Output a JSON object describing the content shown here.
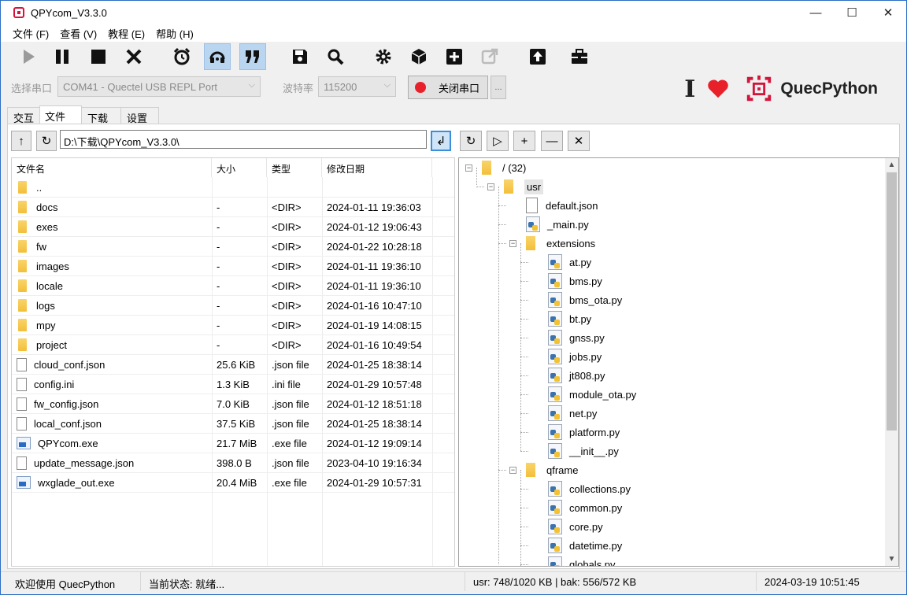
{
  "window": {
    "title": "QPYcom_V3.3.0",
    "controls": {
      "minimize": "—",
      "maximize": "☐",
      "close": "✕"
    }
  },
  "menu": [
    "文件 (F)",
    "查看 (V)",
    "教程 (E)",
    "帮助 (H)"
  ],
  "toolbar": {
    "buttons": [
      "play-icon",
      "pause-icon",
      "stop-icon",
      "cancel-icon",
      "alarm-clock-icon",
      "headset-icon",
      "quote-icon",
      "save-icon",
      "search-icon",
      "gear-icon",
      "cube-icon",
      "plus-icon",
      "external-link-icon",
      "upload-icon",
      "toolbox-icon"
    ]
  },
  "port": {
    "port_label": "选择串口",
    "port_value": "COM41 - Quectel USB REPL Port",
    "baud_label": "波特率",
    "baud_value": "115200",
    "close_button": "关闭串口",
    "more_button": "..."
  },
  "brand": {
    "text": "QuecPython",
    "cursor": "I"
  },
  "tabs": [
    "交互",
    "文件",
    "下载",
    "设置"
  ],
  "local": {
    "path": "D:\\下载\\QPYcom_V3.3.0\\",
    "columns": [
      "文件名",
      "大小",
      "类型",
      "修改日期"
    ],
    "rows": [
      {
        "name": "..",
        "size": "",
        "type": "",
        "date": "",
        "icon": "folder"
      },
      {
        "name": "docs",
        "size": "-",
        "type": "<DIR>",
        "date": "2024-01-11 19:36:03",
        "icon": "folder"
      },
      {
        "name": "exes",
        "size": "-",
        "type": "<DIR>",
        "date": "2024-01-12 19:06:43",
        "icon": "folder"
      },
      {
        "name": "fw",
        "size": "-",
        "type": "<DIR>",
        "date": "2024-01-22 10:28:18",
        "icon": "folder"
      },
      {
        "name": "images",
        "size": "-",
        "type": "<DIR>",
        "date": "2024-01-11 19:36:10",
        "icon": "folder"
      },
      {
        "name": "locale",
        "size": "-",
        "type": "<DIR>",
        "date": "2024-01-11 19:36:10",
        "icon": "folder"
      },
      {
        "name": "logs",
        "size": "-",
        "type": "<DIR>",
        "date": "2024-01-16 10:47:10",
        "icon": "folder"
      },
      {
        "name": "mpy",
        "size": "-",
        "type": "<DIR>",
        "date": "2024-01-19 14:08:15",
        "icon": "folder"
      },
      {
        "name": "project",
        "size": "-",
        "type": "<DIR>",
        "date": "2024-01-16 10:49:54",
        "icon": "folder"
      },
      {
        "name": "cloud_conf.json",
        "size": "25.6 KiB",
        "type": ".json file",
        "date": "2024-01-25 18:38:14",
        "icon": "file"
      },
      {
        "name": "config.ini",
        "size": "1.3 KiB",
        "type": ".ini file",
        "date": "2024-01-29 10:57:48",
        "icon": "file"
      },
      {
        "name": "fw_config.json",
        "size": "7.0 KiB",
        "type": ".json file",
        "date": "2024-01-12 18:51:18",
        "icon": "file"
      },
      {
        "name": "local_conf.json",
        "size": "37.5 KiB",
        "type": ".json file",
        "date": "2024-01-25 18:38:14",
        "icon": "file"
      },
      {
        "name": "QPYcom.exe",
        "size": "21.7 MiB",
        "type": ".exe file",
        "date": "2024-01-12 19:09:14",
        "icon": "exe"
      },
      {
        "name": "update_message.json",
        "size": "398.0 B",
        "type": ".json file",
        "date": "2023-04-10 19:16:34",
        "icon": "file"
      },
      {
        "name": "wxglade_out.exe",
        "size": "20.4 MiB",
        "type": ".exe file",
        "date": "2024-01-29 10:57:31",
        "icon": "exe"
      }
    ]
  },
  "device": {
    "nav": [
      "↻",
      "▷",
      "+",
      "—",
      "✕"
    ],
    "tree": [
      {
        "label": "/ (32)",
        "depth": 0,
        "kind": "folder",
        "toggle": "⊟"
      },
      {
        "label": "usr",
        "depth": 1,
        "kind": "folder",
        "toggle": "⊟",
        "selected": true
      },
      {
        "label": "default.json",
        "depth": 2,
        "kind": "json"
      },
      {
        "label": "_main.py",
        "depth": 2,
        "kind": "py"
      },
      {
        "label": "extensions",
        "depth": 2,
        "kind": "folder",
        "toggle": "⊟"
      },
      {
        "label": "at.py",
        "depth": 3,
        "kind": "py"
      },
      {
        "label": "bms.py",
        "depth": 3,
        "kind": "py"
      },
      {
        "label": "bms_ota.py",
        "depth": 3,
        "kind": "py"
      },
      {
        "label": "bt.py",
        "depth": 3,
        "kind": "py"
      },
      {
        "label": "gnss.py",
        "depth": 3,
        "kind": "py"
      },
      {
        "label": "jobs.py",
        "depth": 3,
        "kind": "py"
      },
      {
        "label": "jt808.py",
        "depth": 3,
        "kind": "py"
      },
      {
        "label": "module_ota.py",
        "depth": 3,
        "kind": "py"
      },
      {
        "label": "net.py",
        "depth": 3,
        "kind": "py"
      },
      {
        "label": "platform.py",
        "depth": 3,
        "kind": "py"
      },
      {
        "label": "__init__.py",
        "depth": 3,
        "kind": "py"
      },
      {
        "label": "qframe",
        "depth": 2,
        "kind": "folder",
        "toggle": "⊟"
      },
      {
        "label": "collections.py",
        "depth": 3,
        "kind": "py"
      },
      {
        "label": "common.py",
        "depth": 3,
        "kind": "py"
      },
      {
        "label": "core.py",
        "depth": 3,
        "kind": "py"
      },
      {
        "label": "datetime.py",
        "depth": 3,
        "kind": "py"
      },
      {
        "label": "globals.py",
        "depth": 3,
        "kind": "py"
      }
    ]
  },
  "status": {
    "welcome": "欢迎使用 QuecPython",
    "state": "当前状态: 就绪...",
    "storage": "usr: 748/1020 KB | bak: 556/572 KB",
    "time": "2024-03-19 10:51:45"
  }
}
